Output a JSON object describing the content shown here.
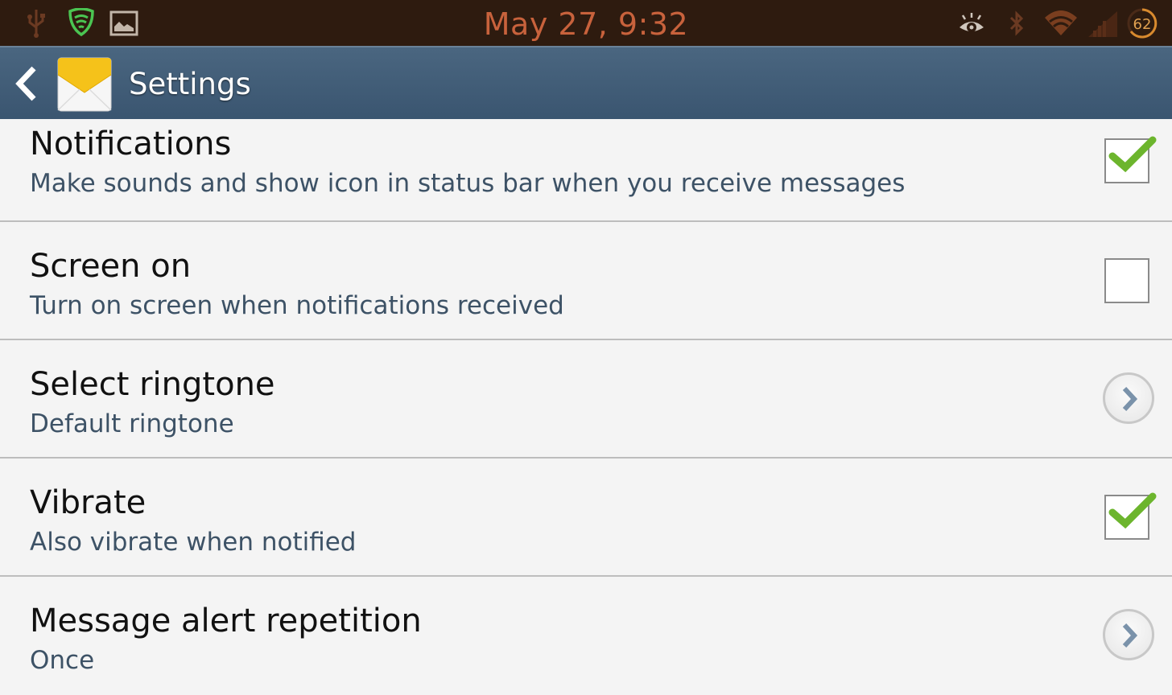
{
  "status_bar": {
    "clock": "May 27, 9:32",
    "battery_level": "62",
    "left_icons": [
      "usb-icon",
      "shield-wifi-icon",
      "image-icon"
    ],
    "right_icons": [
      "eye-icon",
      "bluetooth-icon",
      "wifi-icon",
      "signal-icon",
      "battery-icon"
    ]
  },
  "action_bar": {
    "title": "Settings",
    "back_icon": "back-chevron-icon",
    "app_icon": "envelope-icon"
  },
  "settings": [
    {
      "label": "Notifications",
      "summary": "Make sounds and show icon in status bar when you receive messages",
      "control": "checkbox",
      "checked": true
    },
    {
      "label": "Screen on",
      "summary": "Turn on screen when notifications received",
      "control": "checkbox",
      "checked": false
    },
    {
      "label": "Select ringtone",
      "summary": "Default ringtone",
      "control": "chevron"
    },
    {
      "label": "Vibrate",
      "summary": "Also vibrate when notified",
      "control": "checkbox",
      "checked": true
    },
    {
      "label": "Message alert repetition",
      "summary": "Once",
      "control": "chevron"
    }
  ],
  "colors": {
    "status_bar_bg": "#2e1b0f",
    "clock": "#c8623c",
    "action_bar_bg": "#3f5a73",
    "check_green": "#6cb52d",
    "summary_text": "#3d5266"
  }
}
